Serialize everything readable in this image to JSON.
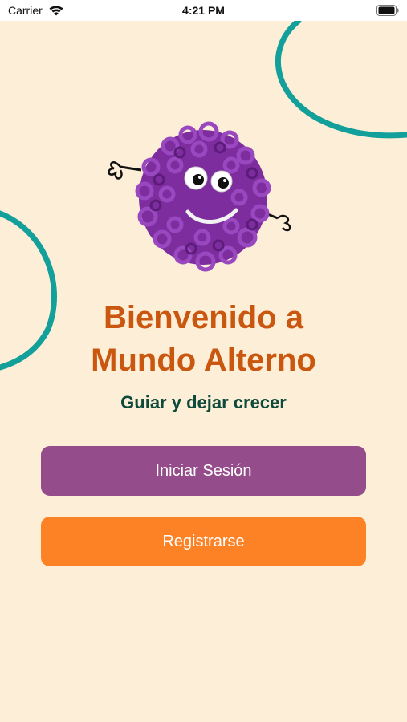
{
  "status_bar": {
    "carrier": "Carrier",
    "time": "4:21 PM"
  },
  "welcome": {
    "title_line1": "Bienvenido a",
    "title_line2": "Mundo Alterno",
    "subtitle": "Guiar y dejar crecer"
  },
  "buttons": {
    "login_label": "Iniciar Sesión",
    "register_label": "Registrarse"
  },
  "icons": {
    "wifi": "wifi-icon",
    "battery": "battery-icon",
    "mascot": "purple-pompom-mascot"
  },
  "colors": {
    "background": "#fdefd7",
    "title": "#c9570f",
    "subtitle": "#0e4a3b",
    "login_button": "#944c8a",
    "register_button": "#fd8225",
    "curve": "#13a09a",
    "mascot": "#7d2d9e"
  }
}
